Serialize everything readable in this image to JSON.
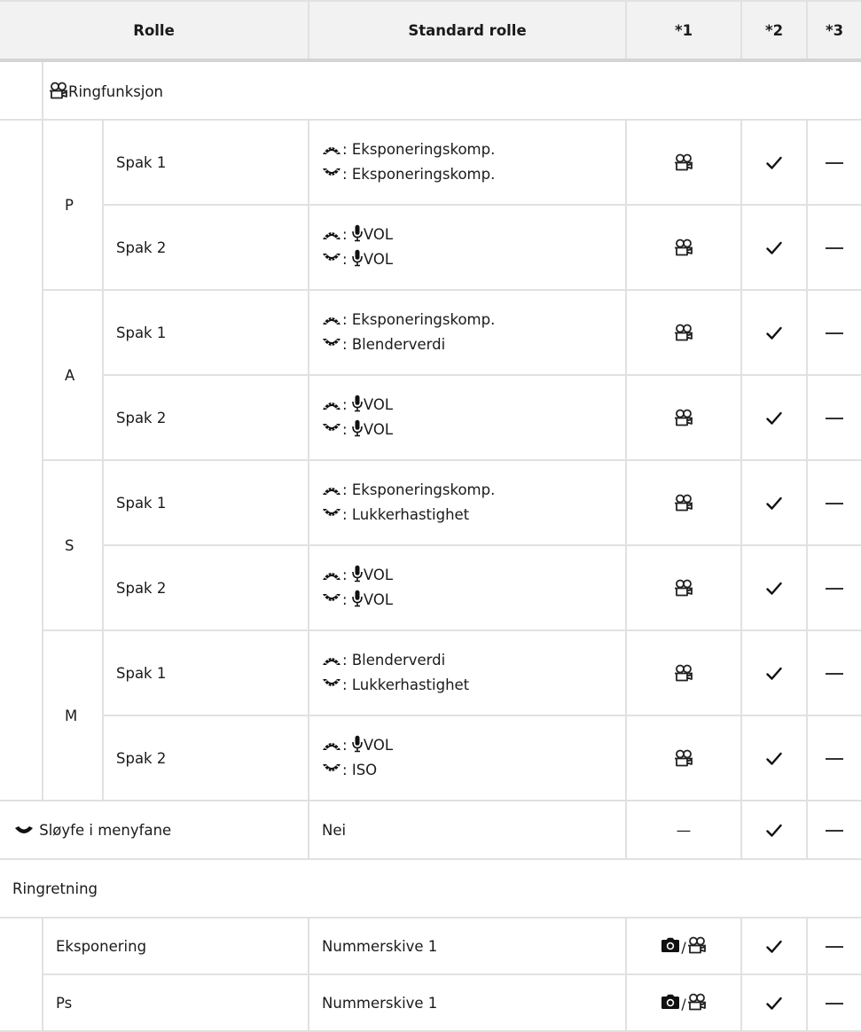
{
  "headers": [
    "Rolle",
    "Standard rolle",
    "*1",
    "*2",
    "*3"
  ],
  "ring_function": {
    "label": "Ringfunksjon",
    "modes": [
      {
        "mode": "P",
        "rows": [
          {
            "lever": "Spak 1",
            "front": "Eksponeringskomp.",
            "rear": "Eksponeringskomp.",
            "front_mic": false,
            "rear_mic": false
          },
          {
            "lever": "Spak 2",
            "front": "VOL",
            "rear": "VOL",
            "front_mic": true,
            "rear_mic": true
          }
        ]
      },
      {
        "mode": "A",
        "rows": [
          {
            "lever": "Spak 1",
            "front": "Eksponeringskomp.",
            "rear": "Blenderverdi",
            "front_mic": false,
            "rear_mic": false
          },
          {
            "lever": "Spak 2",
            "front": "VOL",
            "rear": "VOL",
            "front_mic": true,
            "rear_mic": true
          }
        ]
      },
      {
        "mode": "S",
        "rows": [
          {
            "lever": "Spak 1",
            "front": "Eksponeringskomp.",
            "rear": "Lukkerhastighet",
            "front_mic": false,
            "rear_mic": false
          },
          {
            "lever": "Spak 2",
            "front": "VOL",
            "rear": "VOL",
            "front_mic": true,
            "rear_mic": true
          }
        ]
      },
      {
        "mode": "M",
        "rows": [
          {
            "lever": "Spak 1",
            "front": "Blenderverdi",
            "rear": "Lukkerhastighet",
            "front_mic": false,
            "rear_mic": false
          },
          {
            "lever": "Spak 2",
            "front": "VOL",
            "rear": "ISO",
            "front_mic": true,
            "rear_mic": false
          }
        ]
      }
    ],
    "col1_icon": "movie-icon",
    "col2_icon": "check-icon",
    "col3_icon": "dash-icon"
  },
  "loop": {
    "label": "Sløyfe i menyfane",
    "default": "Nei",
    "col1": "—"
  },
  "ring_direction": {
    "label": "Ringretning",
    "rows": [
      {
        "item": "Eksponering",
        "default": "Nummerskive 1"
      },
      {
        "item": "Ps",
        "default": "Nummerskive 1"
      }
    ],
    "col1_icons": [
      "camera-icon",
      "movie-icon"
    ],
    "col1_separator": "/"
  },
  "colors": {
    "header_bg": "#f2f2f2",
    "grid": "#e1e1e1",
    "header_rule": "#d4d4d4",
    "text": "#1a1a1a"
  }
}
